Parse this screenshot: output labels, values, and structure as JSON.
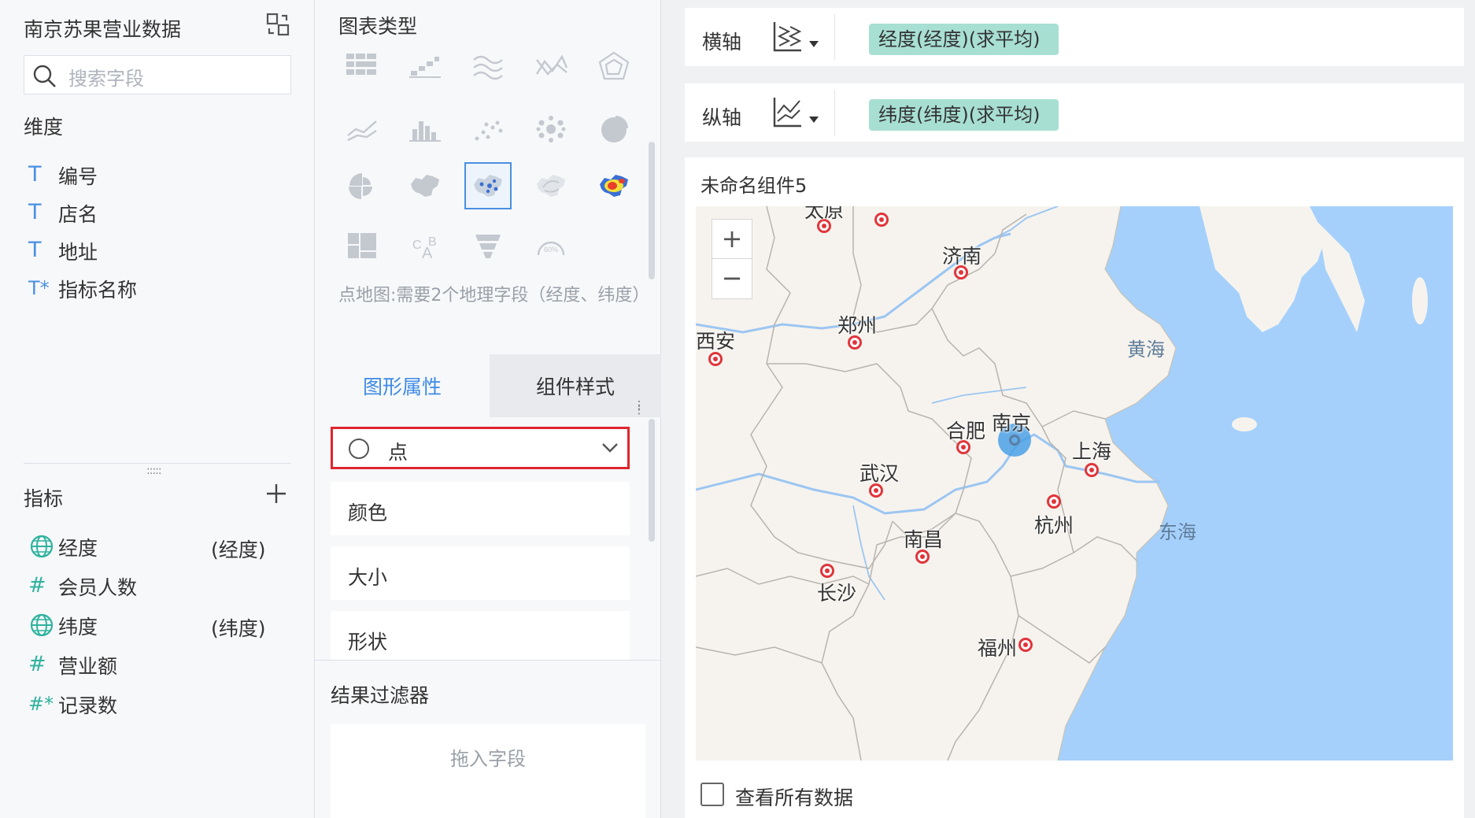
{
  "left": {
    "dataset_title": "南京苏果营业数据",
    "search": {
      "placeholder": "搜索字段"
    },
    "dimensions_title": "维度",
    "dimensions": [
      {
        "icon": "text-field-icon",
        "glyph": "T",
        "label": "编号"
      },
      {
        "icon": "text-field-icon",
        "glyph": "T",
        "label": "店名"
      },
      {
        "icon": "text-field-icon",
        "glyph": "T",
        "label": "地址"
      },
      {
        "icon": "text-calculated-field-icon",
        "glyph": "T*",
        "label": "指标名称"
      }
    ],
    "measures_title": "指标",
    "measures": [
      {
        "icon": "globe-icon",
        "glyph": "",
        "label": "经度",
        "note": "(经度)"
      },
      {
        "icon": "number-field-icon",
        "glyph": "#",
        "label": "会员人数",
        "note": ""
      },
      {
        "icon": "globe-icon",
        "glyph": "",
        "label": "纬度",
        "note": "(纬度)"
      },
      {
        "icon": "number-field-icon",
        "glyph": "#",
        "label": "营业额",
        "note": ""
      },
      {
        "icon": "number-calculated-field-icon",
        "glyph": "#*",
        "label": "记录数",
        "note": ""
      }
    ]
  },
  "middle": {
    "chart_type_title": "图表类型",
    "chart_types": [
      "grouped-table-icon",
      "bar-step-icon",
      "area-stack-icon",
      "line-mixed-icon",
      "radar-icon",
      "line-chart-icon",
      "bar-chart-icon",
      "scatter-icon",
      "bubble-icon",
      "pie-chart-icon",
      "rose-chart-icon",
      "region-map-icon",
      "point-map-icon",
      "flow-map-icon",
      "heat-map-icon",
      "treemap-icon",
      "word-cloud-icon",
      "funnel-icon",
      "gauge-icon"
    ],
    "active_chart_type": "point-map-icon",
    "gauge_text": "60%",
    "chart_type_hint": "点地图:需要2个地理字段（经度、纬度）",
    "tabs": {
      "graphic_props": "图形属性",
      "component_style": "组件样式"
    },
    "shape_select": {
      "value": "点"
    },
    "attr_rows": {
      "color": "颜色",
      "size": "大小",
      "shape": "形状"
    },
    "result_filter_title": "结果过滤器",
    "drop_zone_text": "拖入字段"
  },
  "right": {
    "x_axis": {
      "label": "横轴",
      "field": "经度(经度)(求平均)"
    },
    "y_axis": {
      "label": "纵轴",
      "field": "纬度(纬度)(求平均)"
    },
    "widget_title": "未命名组件5",
    "map": {
      "zoom_in": "+",
      "zoom_out": "−",
      "cities": [
        "太原",
        "济南",
        "郑州",
        "西安",
        "合肥",
        "南京",
        "上海",
        "武汉",
        "杭州",
        "南昌",
        "长沙",
        "福州"
      ],
      "seas": [
        "黄海",
        "东海"
      ]
    },
    "view_all_label": "查看所有数据"
  },
  "colors": {
    "accent": "#3e8be5",
    "pill": "#a8dfd3",
    "highlight_border": "#e0252d",
    "sea": "#a5d0fb",
    "land": "#f6f3ee"
  }
}
